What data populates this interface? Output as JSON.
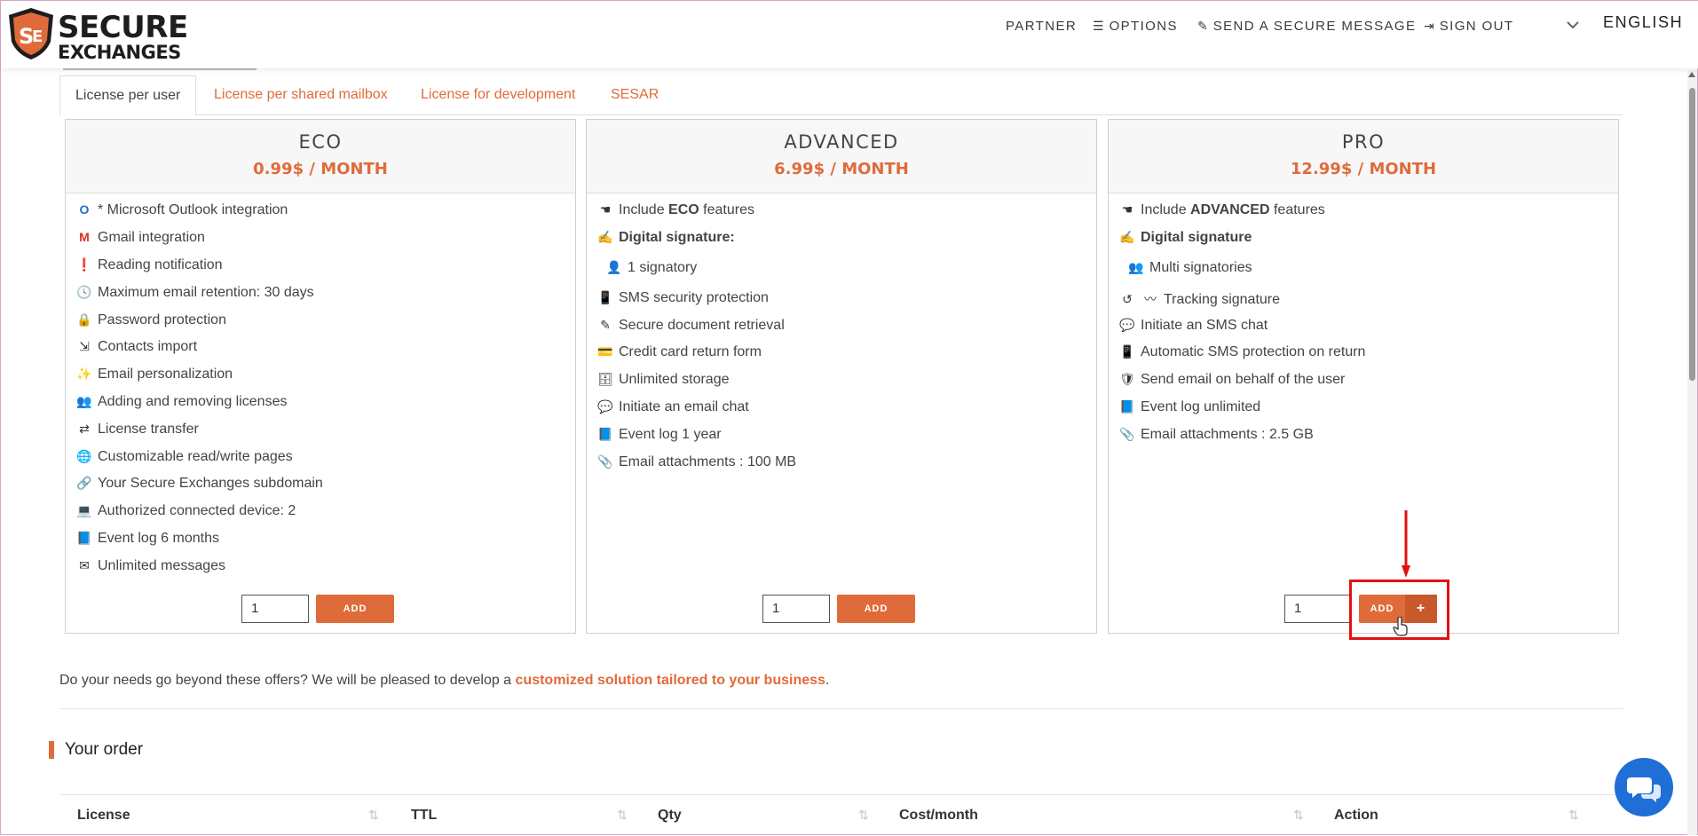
{
  "header": {
    "logo_line1": "SECURE",
    "logo_line2": "EXCHANGES",
    "nav": {
      "partner": "PARTNER",
      "options": "OPTIONS",
      "send": "SEND A SECURE MESSAGE",
      "signout": "SIGN OUT",
      "language": "ENGLISH"
    }
  },
  "tabs": [
    {
      "label": "License per user",
      "active": true
    },
    {
      "label": "License per shared mailbox",
      "active": false
    },
    {
      "label": "License for development",
      "active": false
    },
    {
      "label": "SESAR",
      "active": false
    }
  ],
  "plans": {
    "eco": {
      "title": "ECO",
      "price": "0.99$ / MONTH",
      "features": [
        "* Microsoft Outlook integration",
        "Gmail integration",
        "Reading notification",
        "Maximum email retention: 30 days",
        "Password protection",
        "Contacts import",
        "Email personalization",
        "Adding and removing licenses",
        "License transfer",
        "Customizable read/write pages",
        "Your Secure Exchanges subdomain",
        "Authorized connected device: 2",
        "Event log 6 months",
        "Unlimited messages"
      ],
      "qty": "1",
      "add_label": "ADD"
    },
    "advanced": {
      "title": "ADVANCED",
      "price": "6.99$ / MONTH",
      "include_pre": "Include ",
      "include_bold": "ECO",
      "include_post": " features",
      "digital_signature": "Digital signature:",
      "signatory": "1 signatory",
      "features": [
        "SMS security protection",
        "Secure document retrieval",
        "Credit card return form",
        "Unlimited storage",
        "Initiate an email chat",
        "Event log 1 year",
        "Email attachments : 100 MB"
      ],
      "qty": "1",
      "add_label": "ADD"
    },
    "pro": {
      "title": "PRO",
      "price": "12.99$ / MONTH",
      "include_pre": "Include ",
      "include_bold": "ADVANCED",
      "include_post": " features",
      "digital_signature": "Digital signature",
      "signatory": "Multi signatories",
      "features": [
        "Tracking signature",
        "Initiate an SMS chat",
        "Automatic SMS protection on return",
        "Send email on behalf of the user",
        "Event log unlimited",
        "Email attachments : 2.5 GB"
      ],
      "qty": "1",
      "add_label": "ADD",
      "plus_label": "+"
    }
  },
  "beyond": {
    "text": "Do your needs go beyond these offers? We will be pleased to develop a ",
    "link": "customized solution tailored to your business",
    "end": "."
  },
  "order": {
    "title": "Your order",
    "columns": [
      "License",
      "TTL",
      "Qty",
      "Cost/month",
      "Action"
    ]
  },
  "colors": {
    "accent": "#e06b3a",
    "highlight": "#e01212",
    "chat": "#1f6fd6"
  }
}
